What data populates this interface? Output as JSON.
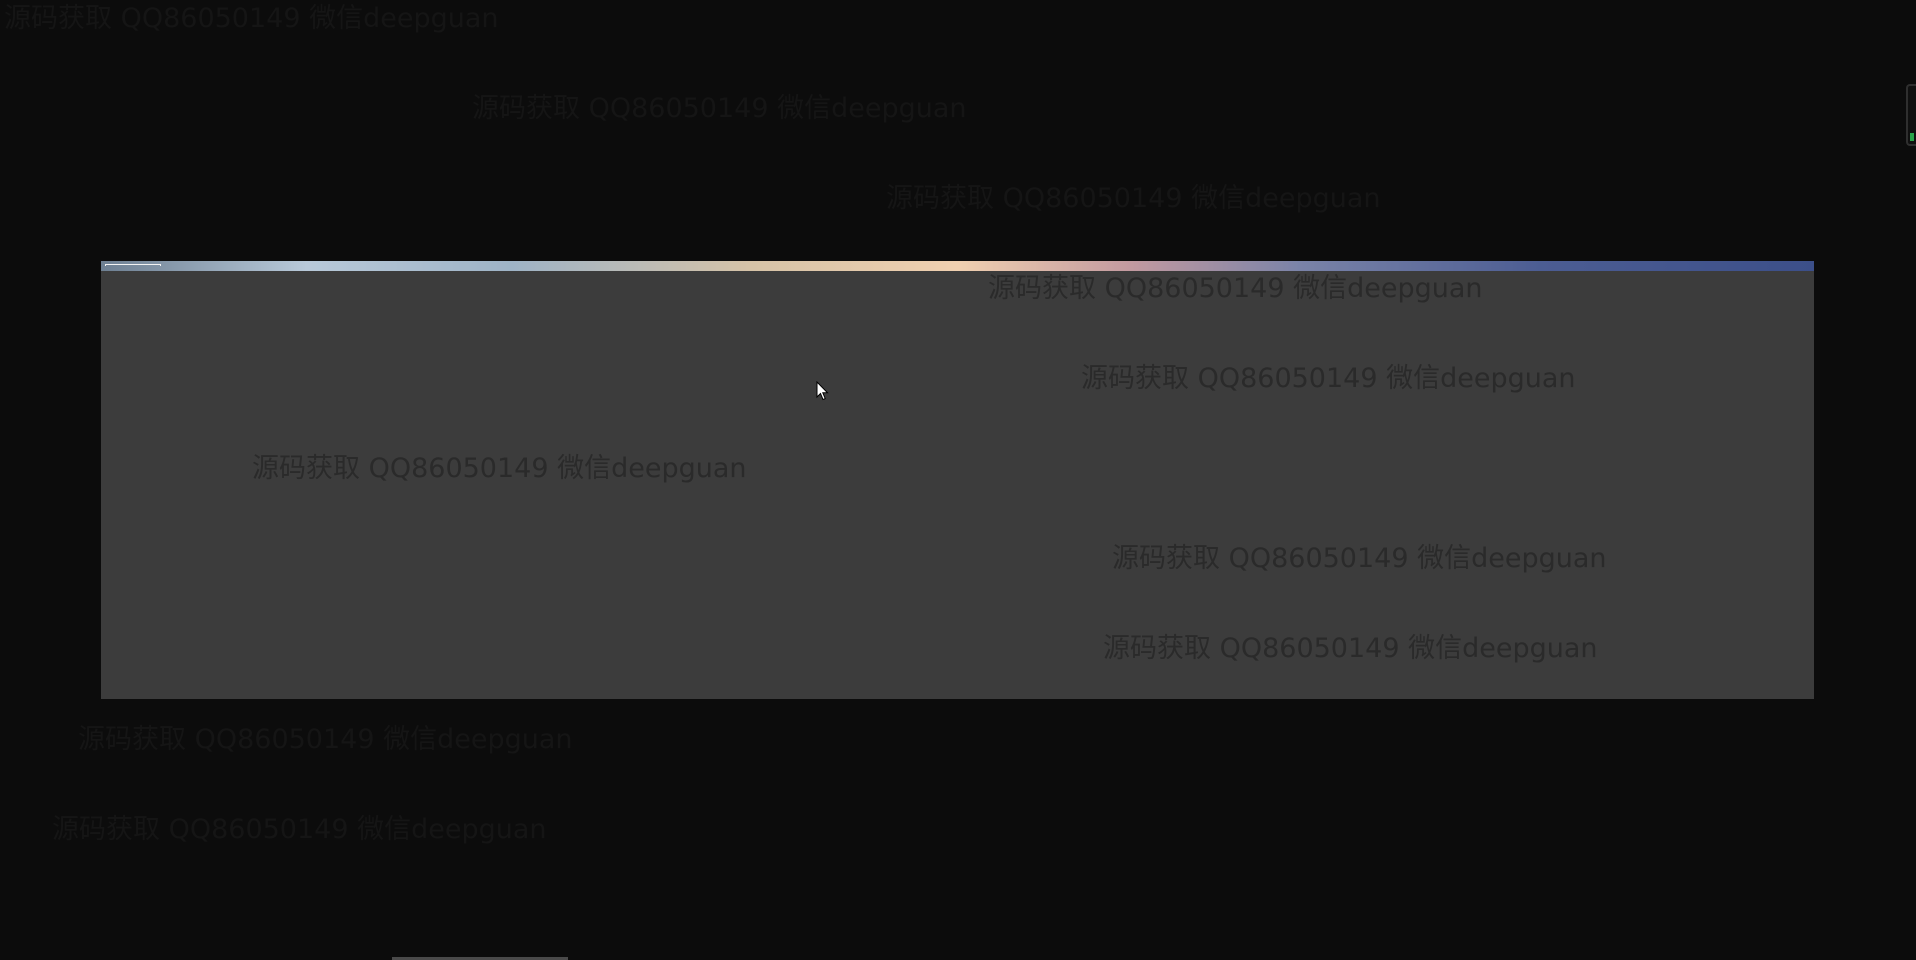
{
  "watermark": {
    "text": "源码获取 QQ86050149 微信deepguan"
  },
  "overlay": {
    "strip_colors": [
      "#6d7f92",
      "#b8c9d9",
      "#d6c3a7",
      "#f0d0b0",
      "#7a83a8",
      "#3c4f89"
    ],
    "panel_color": "#3c3c3c"
  },
  "cursor": {
    "icon": "mouse-pointer-icon"
  },
  "scroll_indicator": {
    "icon": "scroll-indicator-icon",
    "accent": "#2aa44a"
  }
}
